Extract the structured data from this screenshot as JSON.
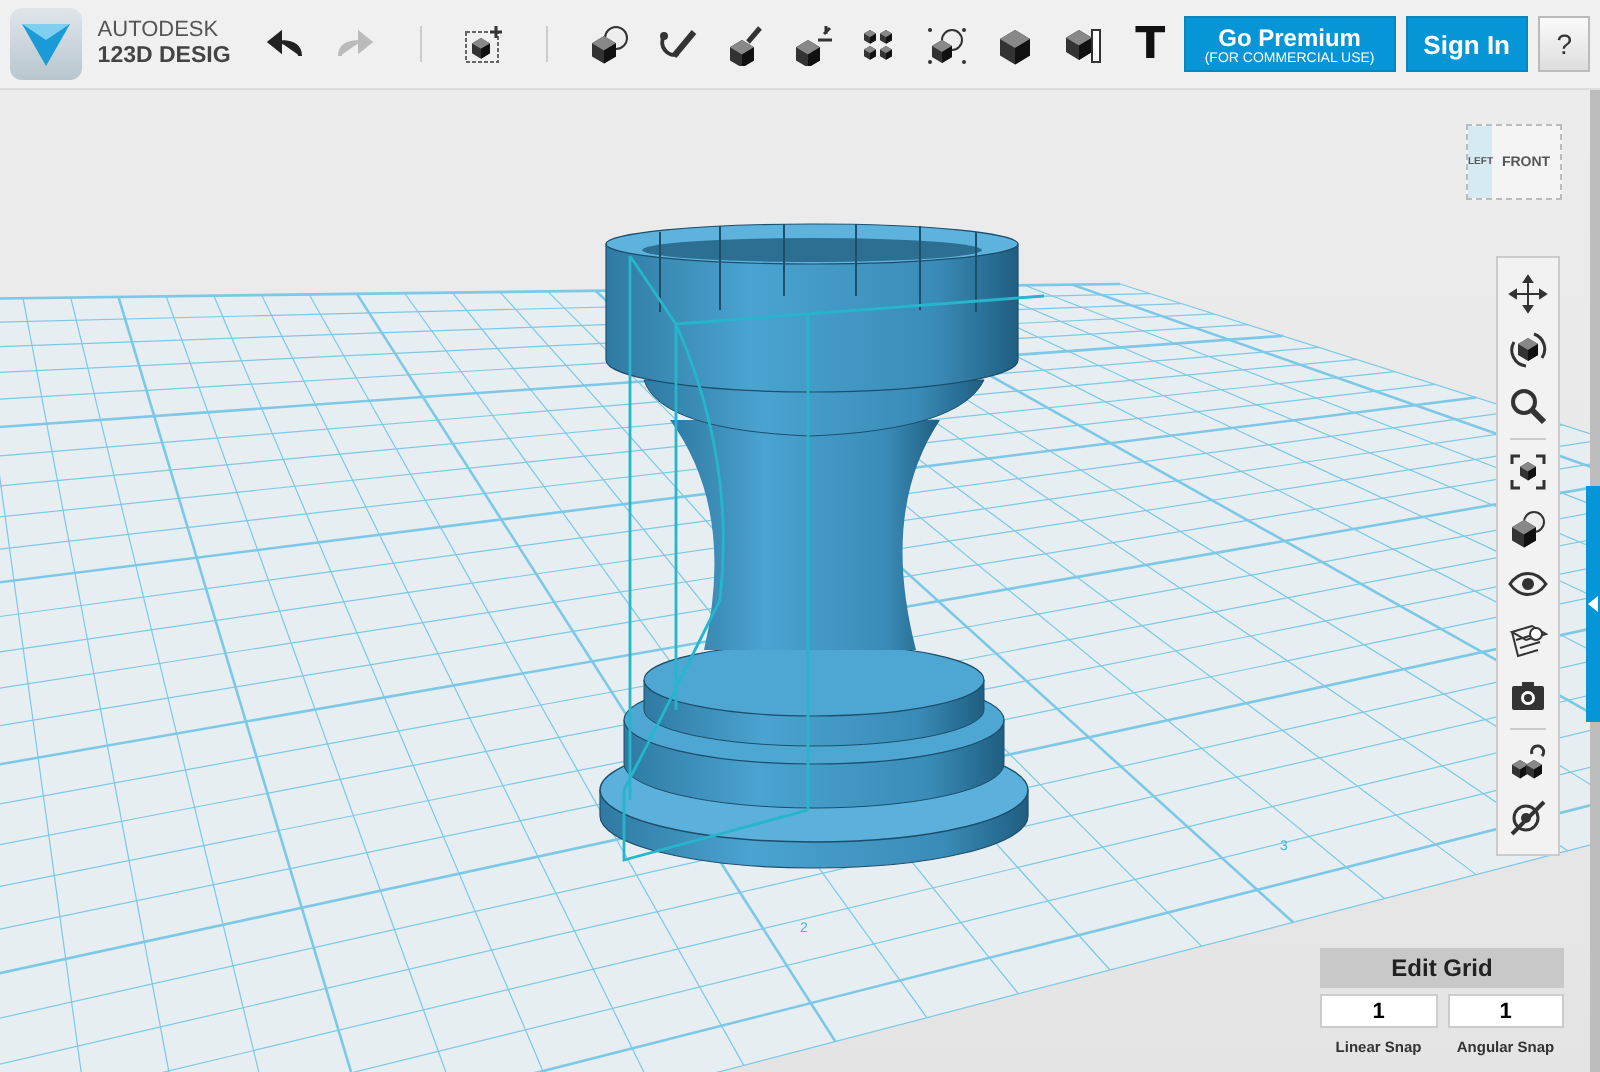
{
  "toolbar": {
    "brand": {
      "company": "AUTODESK",
      "product": "123D DESIG"
    },
    "history": [
      {
        "kind": "undo",
        "disabled": false
      },
      {
        "kind": "redo",
        "disabled": true
      }
    ],
    "tools": [
      {
        "kind": "primitive"
      },
      {
        "kind": "combine"
      },
      {
        "kind": "sketch"
      },
      {
        "kind": "construct"
      },
      {
        "kind": "transform"
      },
      {
        "kind": "pattern"
      },
      {
        "kind": "group"
      },
      {
        "kind": "solid"
      },
      {
        "kind": "measure"
      },
      {
        "kind": "text",
        "label": "T"
      }
    ],
    "premium": {
      "label": "Go Premium",
      "sublabel": "(FOR COMMERCIAL USE)"
    },
    "sign_in": "Sign In",
    "help": "?"
  },
  "viewport": {
    "view_cube": {
      "left": "LEFT",
      "front": "FRONT"
    },
    "grid_labels": [
      "2",
      "3"
    ],
    "nav_tools": [
      {
        "kind": "pan"
      },
      {
        "kind": "orbit"
      },
      {
        "kind": "zoom"
      },
      {
        "kind": "fit"
      },
      {
        "kind": "materials"
      },
      {
        "kind": "visibility"
      },
      {
        "kind": "grid"
      },
      {
        "kind": "snapshot"
      },
      {
        "kind": "snap"
      },
      {
        "kind": "hide"
      }
    ]
  },
  "edit_grid": {
    "title": "Edit Grid",
    "linear_snap": {
      "value": "1",
      "label": "Linear Snap"
    },
    "angular_snap": {
      "value": "1",
      "label": "Angular Snap"
    }
  }
}
